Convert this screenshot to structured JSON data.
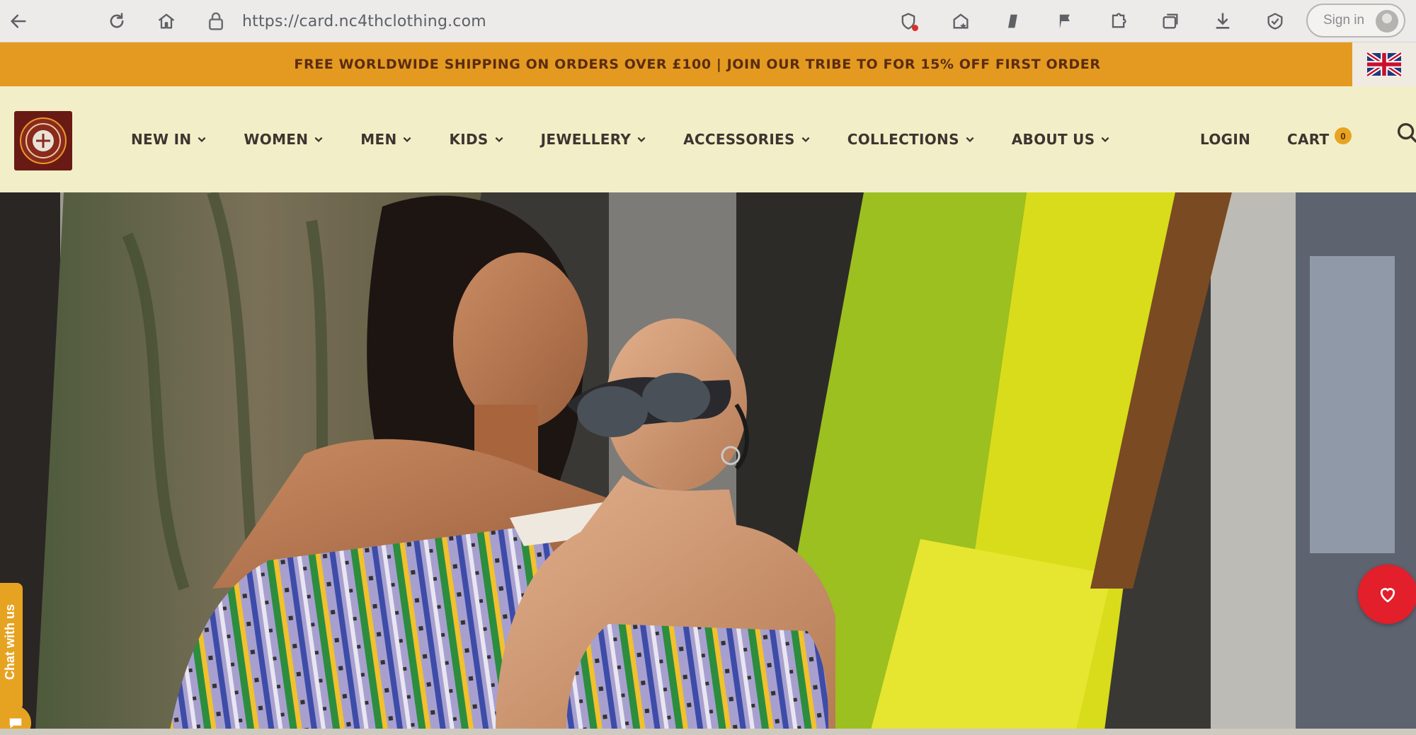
{
  "browser": {
    "url": "https://card.nc4thclothing.com",
    "signin_label": "Sign in",
    "icons": [
      "back-arrow-icon",
      "refresh-icon",
      "home-icon",
      "lock-icon"
    ]
  },
  "announcement": {
    "text": "FREE WORLDWIDE SHIPPING ON ORDERS OVER £100 | JOIN OUR TRIBE TO FOR 15% OFF FIRST ORDER",
    "background": "#e49a20",
    "flag_icon": "uk-flag-icon"
  },
  "header": {
    "background": "#f2efc8",
    "nav": [
      {
        "label": "NEW IN"
      },
      {
        "label": "WOMEN"
      },
      {
        "label": "MEN"
      },
      {
        "label": "KIDS"
      },
      {
        "label": "JEWELLERY"
      },
      {
        "label": "ACCESSORIES"
      },
      {
        "label": "COLLECTIONS"
      },
      {
        "label": "ABOUT US"
      }
    ],
    "login_label": "LOGIN",
    "cart_label": "CART",
    "cart_count": "0"
  },
  "hero": {
    "chat_label": "Chat with us",
    "wishlist_color": "#e21f2a",
    "accent_colors": [
      "#9bc020",
      "#d8dc1a",
      "#e6e530"
    ]
  }
}
